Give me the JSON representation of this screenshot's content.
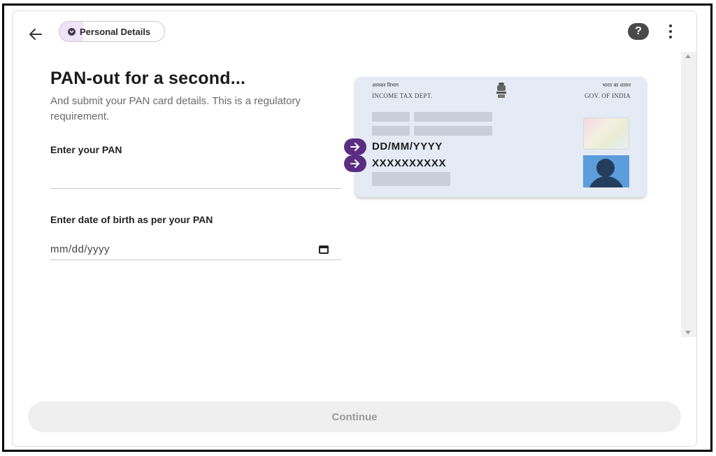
{
  "header": {
    "back_icon": "arrow-left-icon",
    "step_chip_label": "Personal Details",
    "help_label": "?",
    "more_icon": "more-vert-icon"
  },
  "form": {
    "title": "PAN-out for a second...",
    "subtitle": "And submit your PAN card details. This is a regulatory requirement.",
    "pan_label": "Enter your PAN",
    "pan_value": "",
    "dob_label": "Enter date of birth as per your PAN",
    "dob_placeholder": "mm/dd/yyyy"
  },
  "card": {
    "dept_hindi": "आयकर विभाग",
    "dept_english": "INCOME TAX DEPT.",
    "gov_hindi": "भारत का शासन",
    "gov_english": "GOV. OF INDIA",
    "dob_format": "DD/MM/YYYY",
    "pan_format": "XXXXXXXXXX"
  },
  "footer": {
    "continue_label": "Continue"
  },
  "colors": {
    "accent_purple": "#5a2d82",
    "card_bg": "#e4ebf4",
    "chip_tint": "#efe3f7",
    "disabled_button": "#efefef"
  }
}
